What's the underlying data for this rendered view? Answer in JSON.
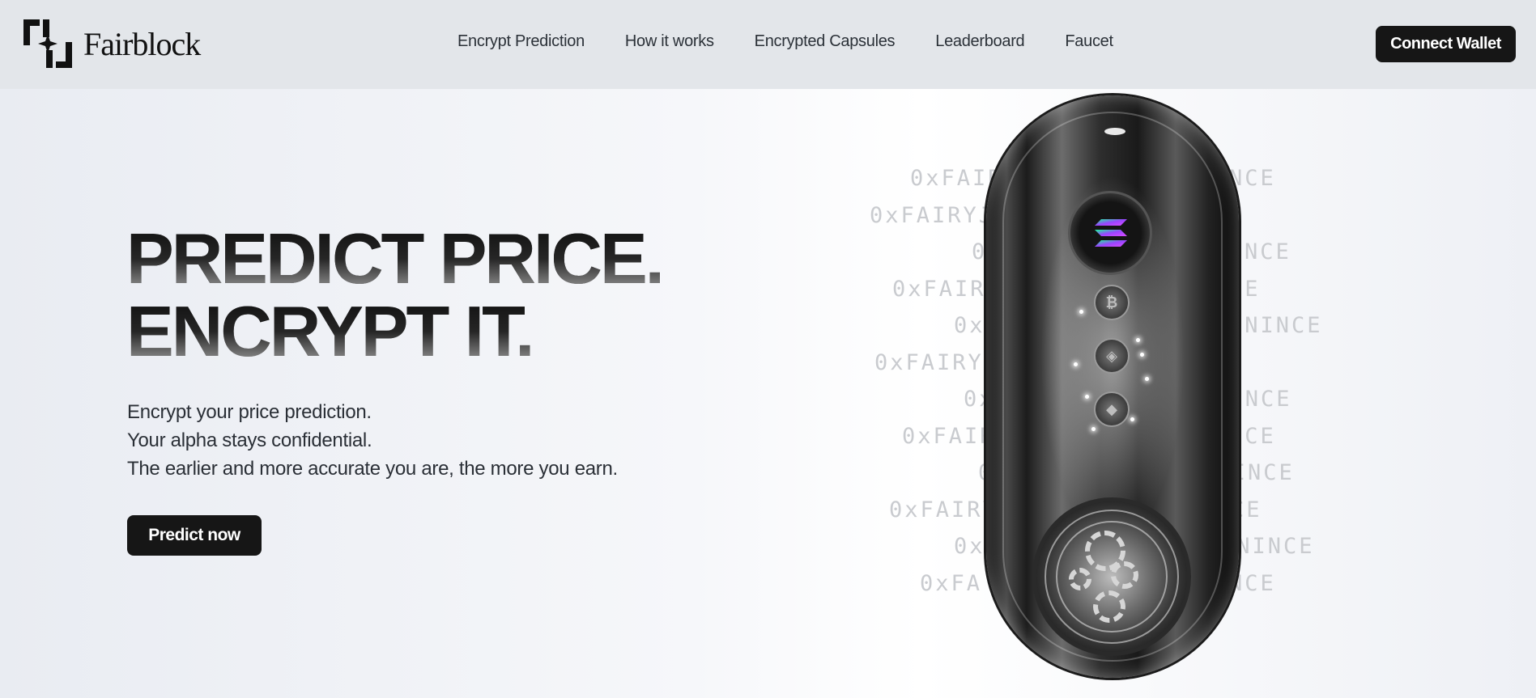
{
  "brand": {
    "name": "Fairblock"
  },
  "nav": {
    "items": [
      {
        "label": "Encrypt Prediction"
      },
      {
        "label": "How it works"
      },
      {
        "label": "Encrypted Capsules"
      },
      {
        "label": "Leaderboard"
      },
      {
        "label": "Faucet"
      }
    ],
    "connect_label": "Connect Wallet"
  },
  "hero": {
    "headline_1": "PREDICT PRICE.",
    "headline_2": "ENCRYPT IT.",
    "sub_1": "Encrypt your price prediction.",
    "sub_2": "Your alpha stays confidential.",
    "sub_3": "The earlier and more accurate you are, the more you earn.",
    "cta_label": "Predict now"
  },
  "background_text": {
    "lines": [
      {
        "left": "0xFAIR",
        "right": "NCE"
      },
      {
        "left": "0xFAIRYJ",
        "right": "E"
      },
      {
        "left": "0",
        "right": "VDNINCE"
      },
      {
        "left": "0xFAIRY",
        "right": "CE"
      },
      {
        "left": "0x",
        "right": "DNINCE"
      },
      {
        "left": "0xFAIRYJ",
        "right": "E"
      },
      {
        "left": "0x",
        "right": "DNINCE"
      },
      {
        "left": "0xFAIR",
        "right": "NCE"
      },
      {
        "left": "0",
        "right": "VDNINCE"
      },
      {
        "left": "0xFAIRY",
        "right": "CE"
      },
      {
        "left": "0xF",
        "right": "DNINCE"
      },
      {
        "left": "0xFA",
        "right": "NCE"
      }
    ]
  },
  "capsule": {
    "main_token_icon": "solana-icon",
    "coin_icons": [
      "bitcoin-icon",
      "token-icon",
      "ethereum-icon"
    ],
    "coin_glyphs": [
      "₿",
      "◈",
      "◆"
    ]
  },
  "colors": {
    "header_bg": "#e3e6ea",
    "button_bg": "#161616",
    "button_text": "#ffffff",
    "nav_text": "#2b3138"
  }
}
